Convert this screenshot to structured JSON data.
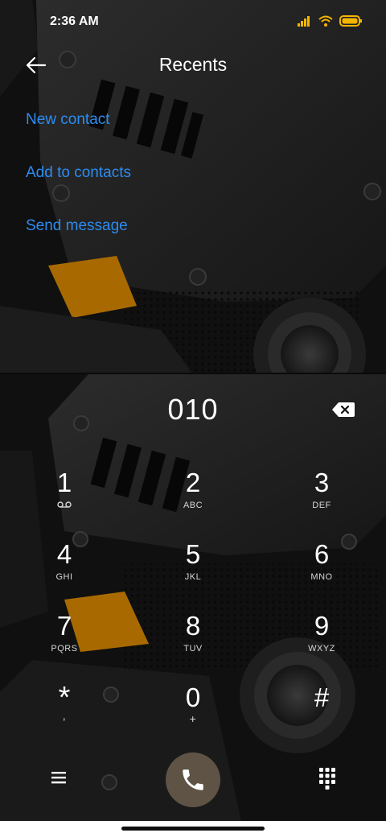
{
  "status_bar": {
    "time": "2:36 AM"
  },
  "header": {
    "title": "Recents"
  },
  "actions": [
    {
      "label": "New contact"
    },
    {
      "label": "Add to contacts"
    },
    {
      "label": "Send message"
    }
  ],
  "dialer": {
    "number": "010",
    "keys": [
      {
        "digit": "1",
        "letters": ""
      },
      {
        "digit": "2",
        "letters": "ABC"
      },
      {
        "digit": "3",
        "letters": "DEF"
      },
      {
        "digit": "4",
        "letters": "GHI"
      },
      {
        "digit": "5",
        "letters": "JKL"
      },
      {
        "digit": "6",
        "letters": "MNO"
      },
      {
        "digit": "7",
        "letters": "PQRS"
      },
      {
        "digit": "8",
        "letters": "TUV"
      },
      {
        "digit": "9",
        "letters": "WXYZ"
      },
      {
        "digit": "*",
        "letters": ","
      },
      {
        "digit": "0",
        "letters": "+"
      },
      {
        "digit": "#",
        "letters": ""
      }
    ]
  },
  "colors": {
    "accent": "#2d8cf0",
    "call_button": "#5e5345",
    "battery": "#f5b500"
  },
  "icons": [
    "signal-icon",
    "wifi-icon",
    "battery-icon",
    "back-arrow-icon",
    "backspace-icon",
    "voicemail-icon",
    "menu-icon",
    "phone-icon",
    "dialpad-icon"
  ]
}
